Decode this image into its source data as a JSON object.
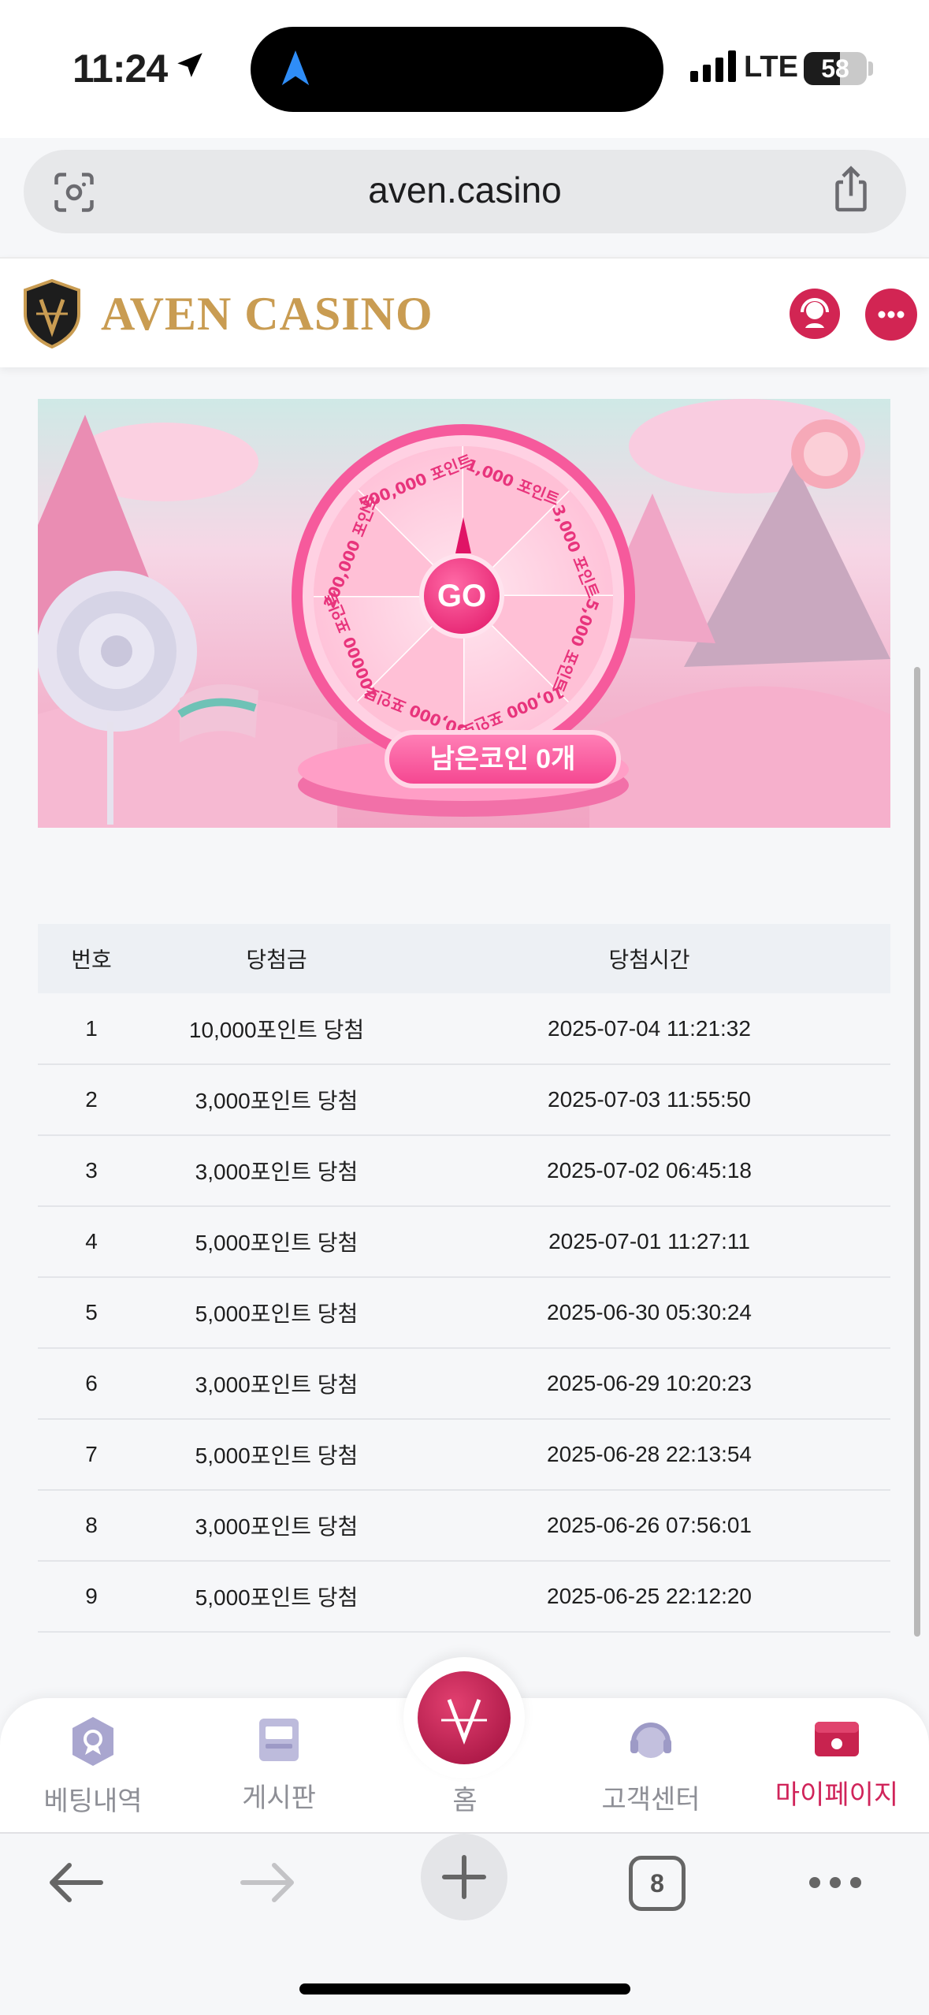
{
  "status_bar": {
    "time": "11:24",
    "network": "LTE",
    "battery": "58",
    "battery_level": 0.58
  },
  "browser": {
    "url": "aven.casino",
    "tab_count": "8"
  },
  "site": {
    "brand": "AVEN CASINO"
  },
  "banner": {
    "wheel_segments": [
      "500,000 포인트",
      "1,000 포인트",
      "3,000 포인트",
      "5,000 포인트",
      "10,000 포인트",
      "50,000 포인트",
      "100000 포인트",
      "200,000 포인트"
    ],
    "go_label": "GO",
    "remaining_coins": "남은코인 0개"
  },
  "table": {
    "headers": [
      "번호",
      "당첨금",
      "당첨시간"
    ],
    "rows": [
      {
        "no": "1",
        "prize": "10,000포인트 당첨",
        "time": "2025-07-04 11:21:32"
      },
      {
        "no": "2",
        "prize": "3,000포인트 당첨",
        "time": "2025-07-03 11:55:50"
      },
      {
        "no": "3",
        "prize": "3,000포인트 당첨",
        "time": "2025-07-02 06:45:18"
      },
      {
        "no": "4",
        "prize": "5,000포인트 당첨",
        "time": "2025-07-01 11:27:11"
      },
      {
        "no": "5",
        "prize": "5,000포인트 당첨",
        "time": "2025-06-30 05:30:24"
      },
      {
        "no": "6",
        "prize": "3,000포인트 당첨",
        "time": "2025-06-29 10:20:23"
      },
      {
        "no": "7",
        "prize": "5,000포인트 당첨",
        "time": "2025-06-28 22:13:54"
      },
      {
        "no": "8",
        "prize": "3,000포인트 당첨",
        "time": "2025-06-26 07:56:01"
      },
      {
        "no": "9",
        "prize": "5,000포인트 당첨",
        "time": "2025-06-25 22:12:20"
      }
    ]
  },
  "bottom_nav": {
    "betting": "베팅내역",
    "board": "게시판",
    "home": "홈",
    "support": "고객센터",
    "mypage": "마이페이지"
  },
  "colors": {
    "accent": "#d0245a",
    "brand_gold": "#c99c52",
    "wheel_pink": "#f54791"
  }
}
